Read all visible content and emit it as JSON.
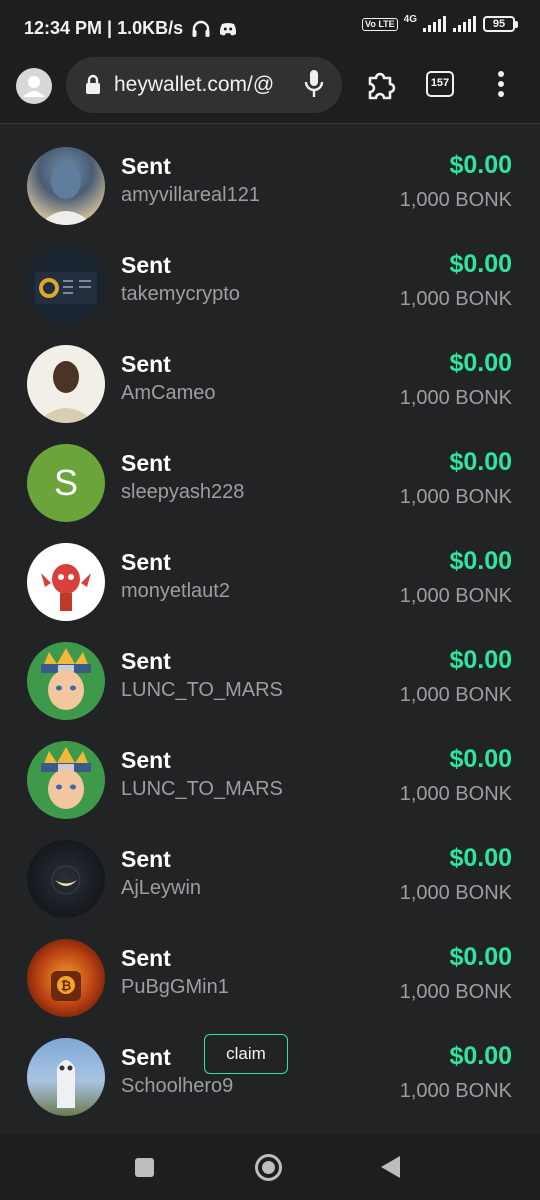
{
  "status_bar": {
    "time_speed": "12:34 PM | 1.0KB/s",
    "volte": "Vo LTE",
    "network": "4G",
    "battery": "95"
  },
  "browser": {
    "url": "heywallet.com/@",
    "tab_count": "157"
  },
  "colors": {
    "accent_green": "#2ee59d",
    "background": "#222325",
    "muted_text": "#9d9ea1"
  },
  "transactions": [
    {
      "status": "Sent",
      "user": "amyvillareal121",
      "amount": "$0.00",
      "token": "1,000 BONK"
    },
    {
      "status": "Sent",
      "user": "takemycrypto",
      "amount": "$0.00",
      "token": "1,000 BONK"
    },
    {
      "status": "Sent",
      "user": "AmCameo",
      "amount": "$0.00",
      "token": "1,000 BONK"
    },
    {
      "status": "Sent",
      "user": "sleepyash228",
      "amount": "$0.00",
      "token": "1,000 BONK",
      "avatar_letter": "S"
    },
    {
      "status": "Sent",
      "user": "monyetlaut2",
      "amount": "$0.00",
      "token": "1,000 BONK"
    },
    {
      "status": "Sent",
      "user": "LUNC_TO_MARS",
      "amount": "$0.00",
      "token": "1,000 BONK"
    },
    {
      "status": "Sent",
      "user": "LUNC_TO_MARS",
      "amount": "$0.00",
      "token": "1,000 BONK"
    },
    {
      "status": "Sent",
      "user": "AjLeywin",
      "amount": "$0.00",
      "token": "1,000 BONK"
    },
    {
      "status": "Sent",
      "user": "PuBgGMin1",
      "amount": "$0.00",
      "token": "1,000 BONK"
    },
    {
      "status": "Sent",
      "user": "Schoolhero9",
      "amount": "$0.00",
      "token": "1,000 BONK",
      "claim_label": "claim"
    }
  ]
}
